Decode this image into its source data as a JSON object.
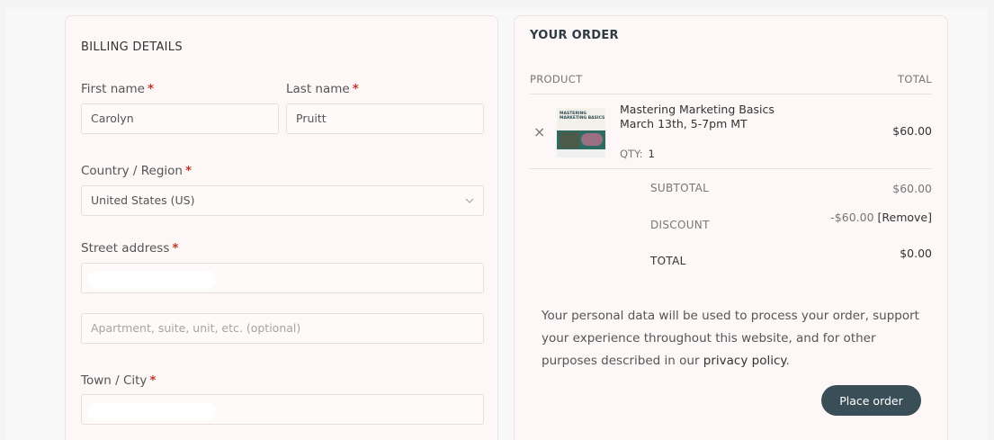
{
  "billing": {
    "title": "BILLING DETAILS",
    "first_name_label": "First name",
    "first_name_value": "Carolyn",
    "last_name_label": "Last name",
    "last_name_value": "Pruitt",
    "country_label": "Country / Region",
    "country_value": "United States (US)",
    "street_label": "Street address",
    "apartment_placeholder": "Apartment, suite, unit, etc. (optional)",
    "city_label": "Town / City",
    "required_mark": "*"
  },
  "order": {
    "title": "YOUR ORDER",
    "col_product": "PRODUCT",
    "col_total": "TOTAL",
    "item": {
      "name": "Mastering Marketing Basics",
      "date": "March 13th, 5-7pm MT",
      "qty_label": "QTY:",
      "qty_value": "1",
      "price": "$60.00",
      "remove_icon": "×",
      "thumb_text": "MASTERING MARKETING BASICS"
    },
    "subtotal_label": "SUBTOTAL",
    "subtotal_value": "$60.00",
    "discount_label": "DISCOUNT",
    "discount_value": "-$60.00",
    "discount_remove": "[Remove]",
    "total_label": "TOTAL",
    "total_value": "$0.00",
    "privacy_text": "Your personal data will be used to process your order, support your experience throughout this website, and for other purposes described in our ",
    "privacy_link": "privacy policy",
    "privacy_end": ".",
    "place_order": "Place order"
  },
  "icons": {
    "select_chevron": "chevron-down-icon",
    "remove": "close-icon"
  }
}
